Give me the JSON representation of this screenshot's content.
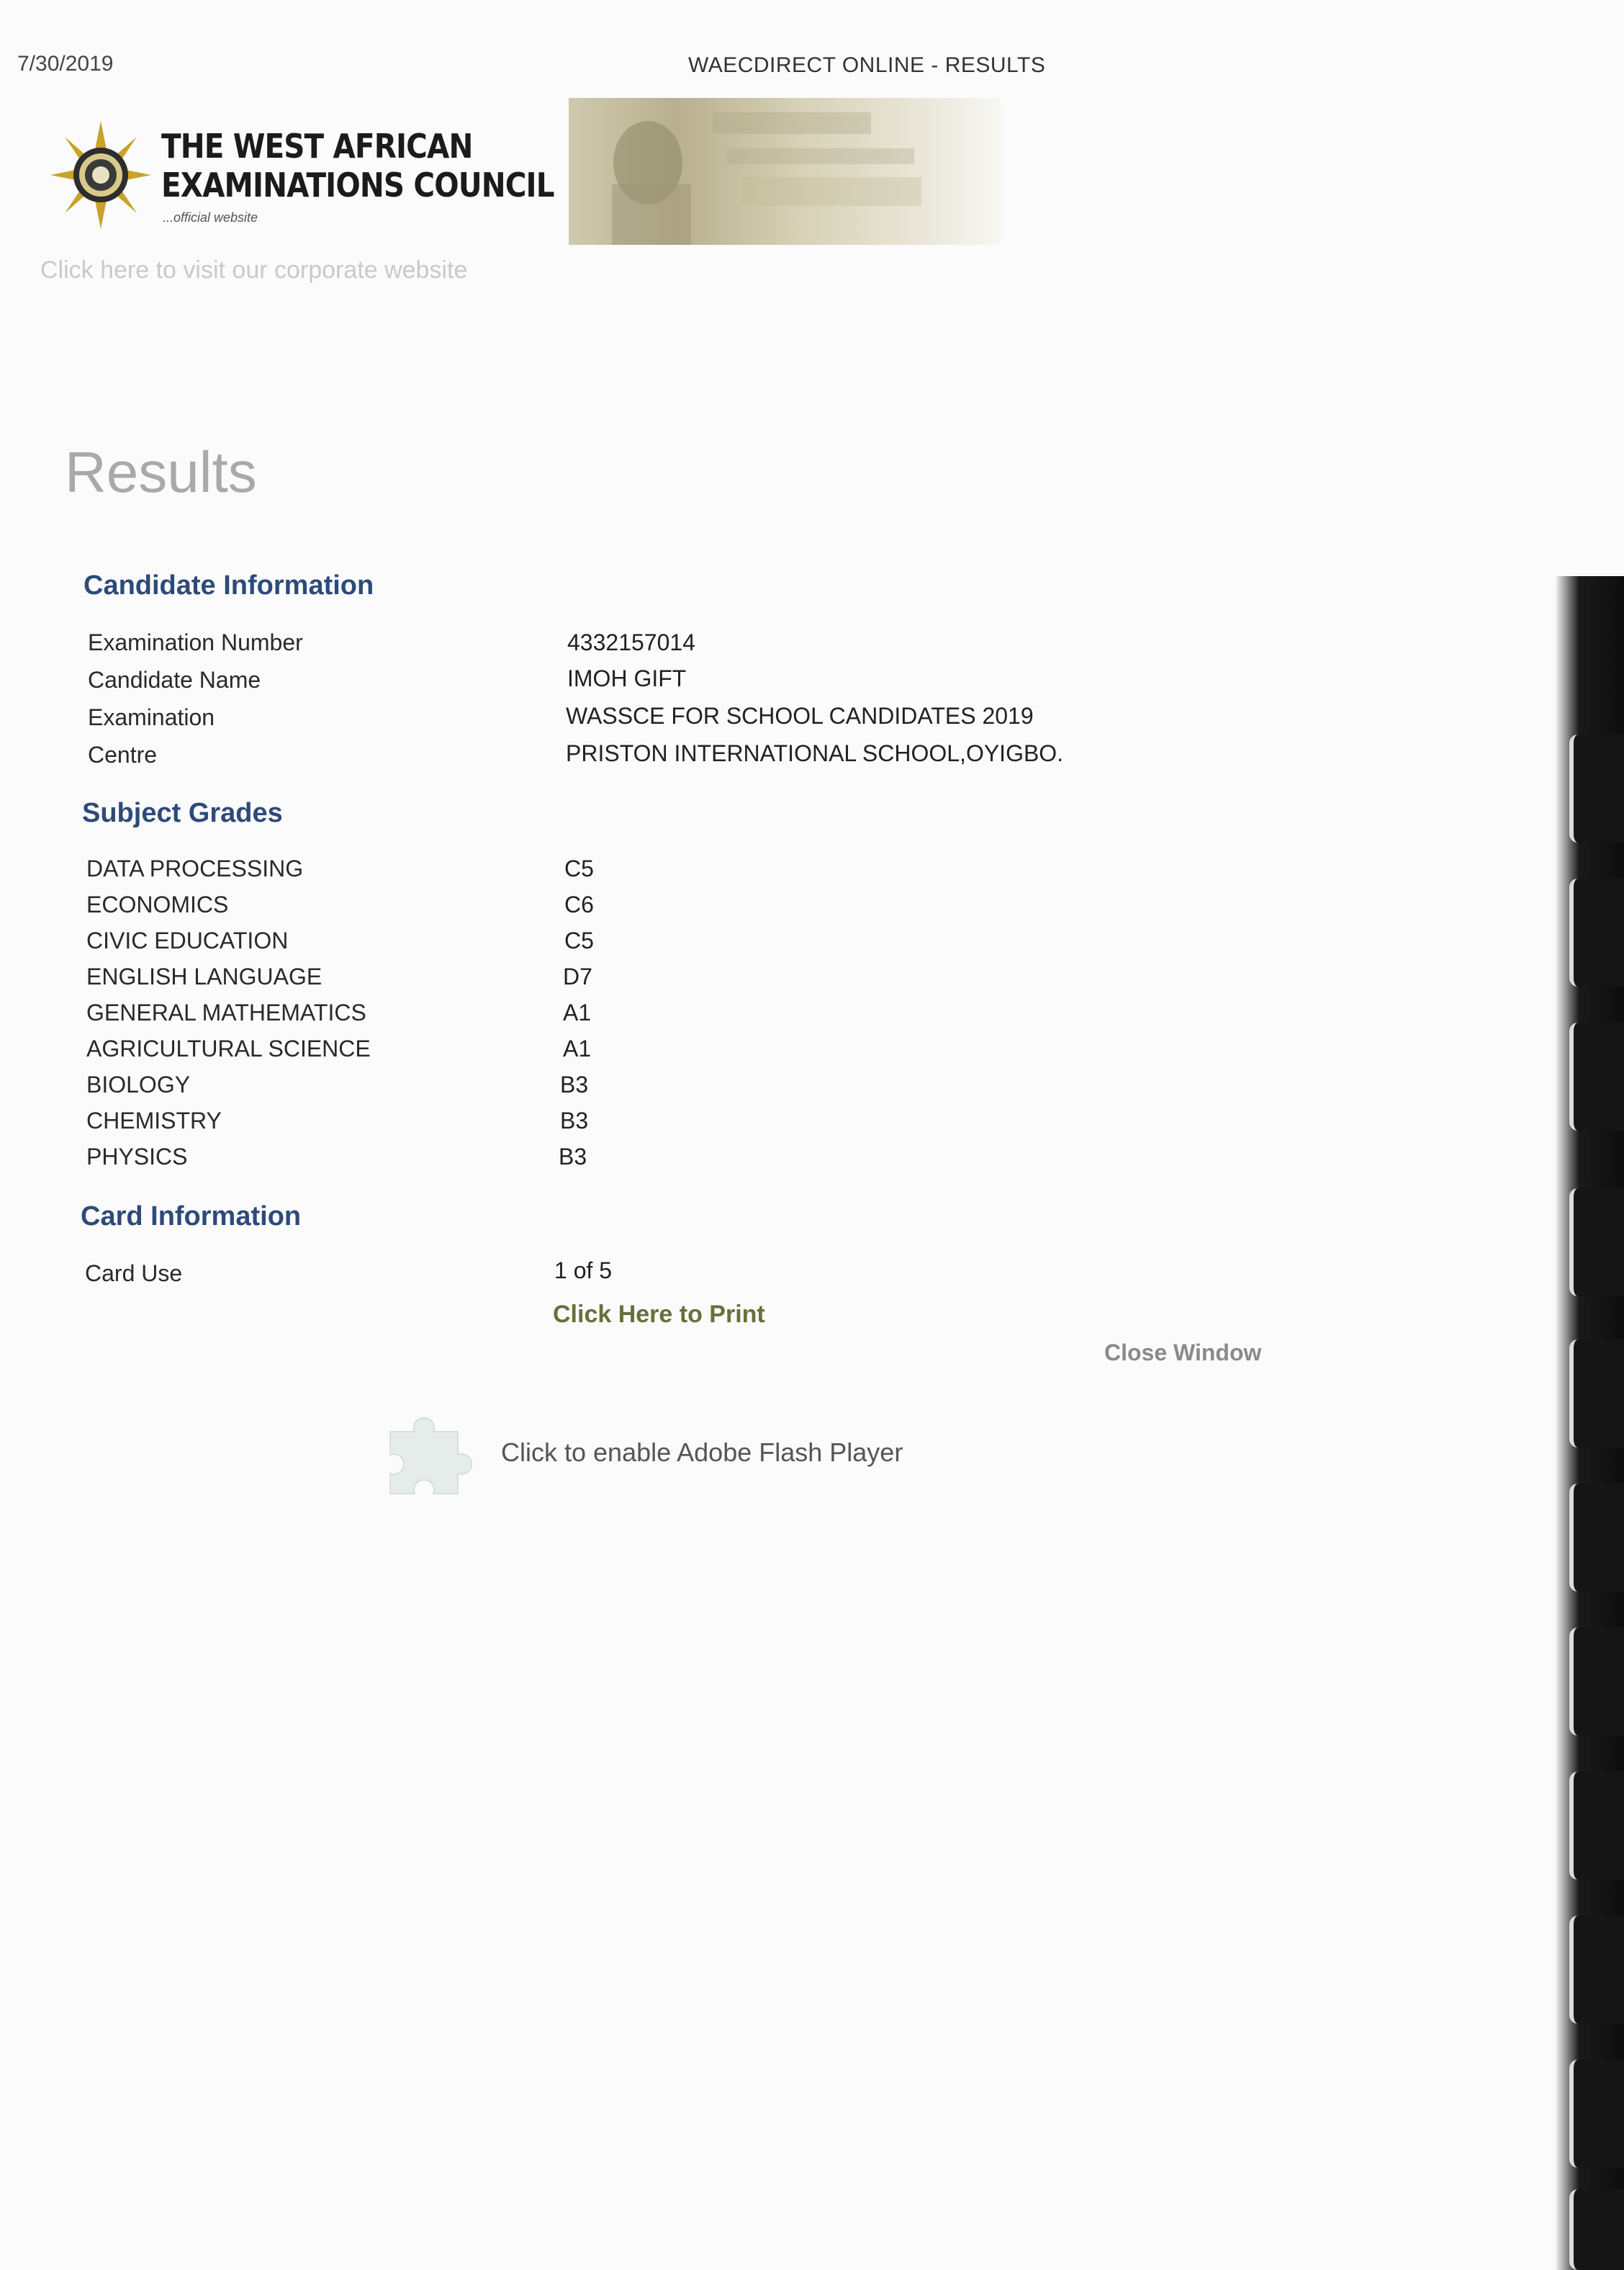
{
  "print_header": {
    "date": "7/30/2019",
    "title": "WAECDIRECT ONLINE - RESULTS"
  },
  "logo": {
    "line1": "THE WEST AFRICAN",
    "line2": "EXAMINATIONS COUNCIL",
    "subtitle": "...official website"
  },
  "corporate_link": "Click here to visit our corporate website",
  "results_heading": "Results",
  "candidate": {
    "title": "Candidate Information",
    "rows": [
      {
        "label": "Examination Number",
        "value": "4332157014"
      },
      {
        "label": "Candidate Name",
        "value": "IMOH GIFT"
      },
      {
        "label": "Examination",
        "value": "WASSCE FOR SCHOOL CANDIDATES 2019"
      },
      {
        "label": "Centre",
        "value": "PRISTON INTERNATIONAL SCHOOL,OYIGBO."
      }
    ]
  },
  "grades": {
    "title": "Subject Grades",
    "rows": [
      {
        "subject": "DATA PROCESSING",
        "grade": "C5"
      },
      {
        "subject": "ECONOMICS",
        "grade": "C6"
      },
      {
        "subject": "CIVIC EDUCATION",
        "grade": "C5"
      },
      {
        "subject": "ENGLISH LANGUAGE",
        "grade": "D7"
      },
      {
        "subject": "GENERAL MATHEMATICS",
        "grade": "A1"
      },
      {
        "subject": "AGRICULTURAL SCIENCE",
        "grade": "A1"
      },
      {
        "subject": "BIOLOGY",
        "grade": "B3"
      },
      {
        "subject": "CHEMISTRY",
        "grade": "B3"
      },
      {
        "subject": "PHYSICS",
        "grade": "B3"
      }
    ]
  },
  "card": {
    "title": "Card Information",
    "label": "Card Use",
    "value": "1 of 5"
  },
  "actions": {
    "print": "Click Here to Print",
    "close": "Close Window",
    "flash": "Click to enable Adobe Flash Player"
  },
  "colors": {
    "section_title": "#2e4a7a",
    "results_heading": "#a9a9a9",
    "print_link": "#6a6f3a"
  },
  "icons": [
    "waec-emblem-icon",
    "puzzle-plugin-icon"
  ]
}
